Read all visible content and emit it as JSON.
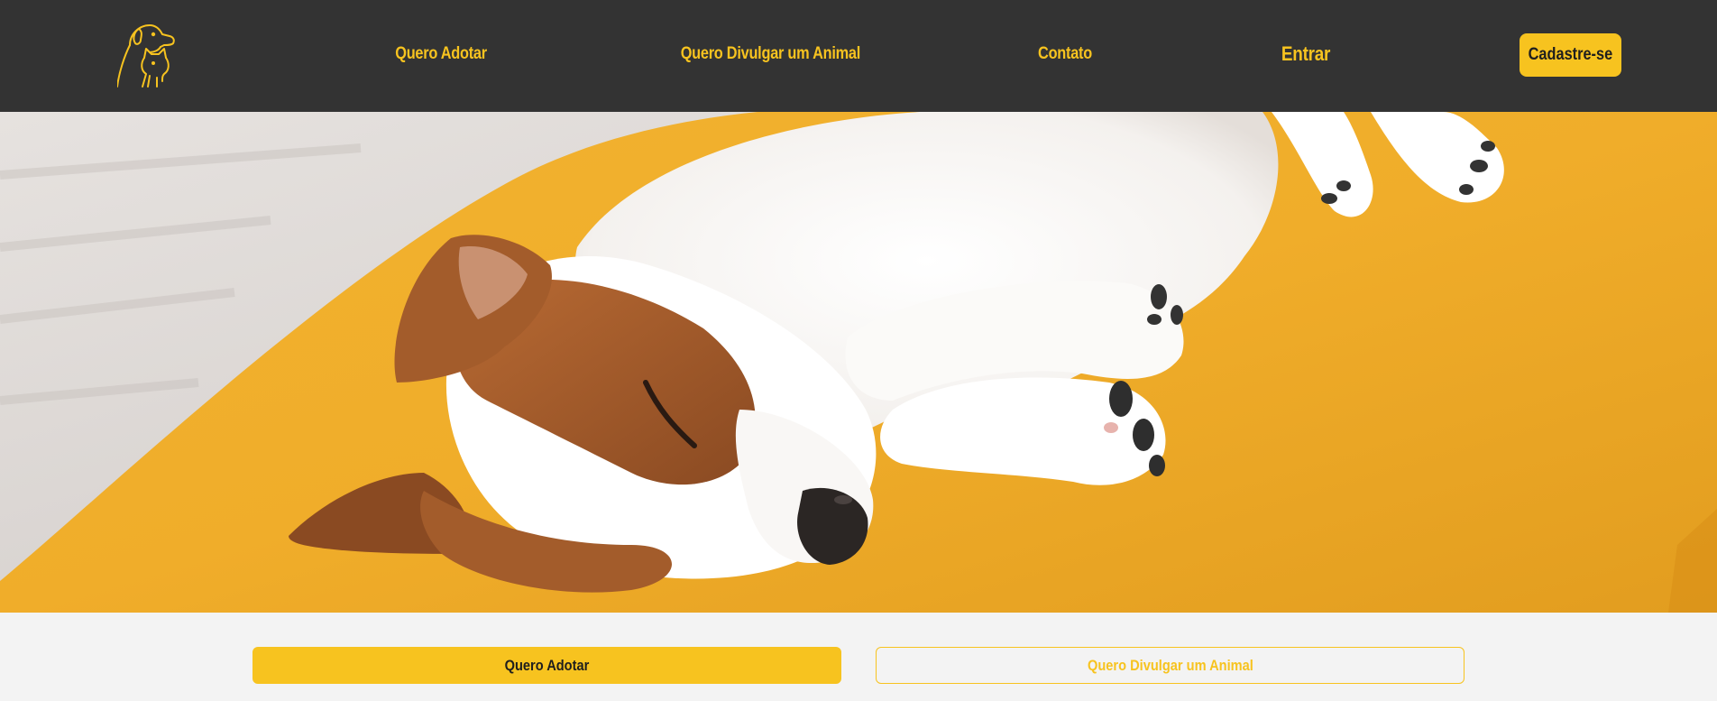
{
  "header": {
    "logo_icon": "dog-and-cat-logo-icon",
    "nav": {
      "adotar": "Quero Adotar",
      "divulgar": "Quero Divulgar um Animal",
      "contato": "Contato",
      "entrar": "Entrar"
    },
    "signup_label": "Cadastre-se"
  },
  "hero": {
    "image": "sleeping-puppy-on-yellow-pillow"
  },
  "actions": {
    "primary_label": "Quero Adotar",
    "secondary_label": "Quero Divulgar um Animal"
  },
  "colors": {
    "header_bg": "#333333",
    "accent": "#f7c31f",
    "page_bg": "#f3f3f3",
    "button_text": "#1e1e1e"
  }
}
